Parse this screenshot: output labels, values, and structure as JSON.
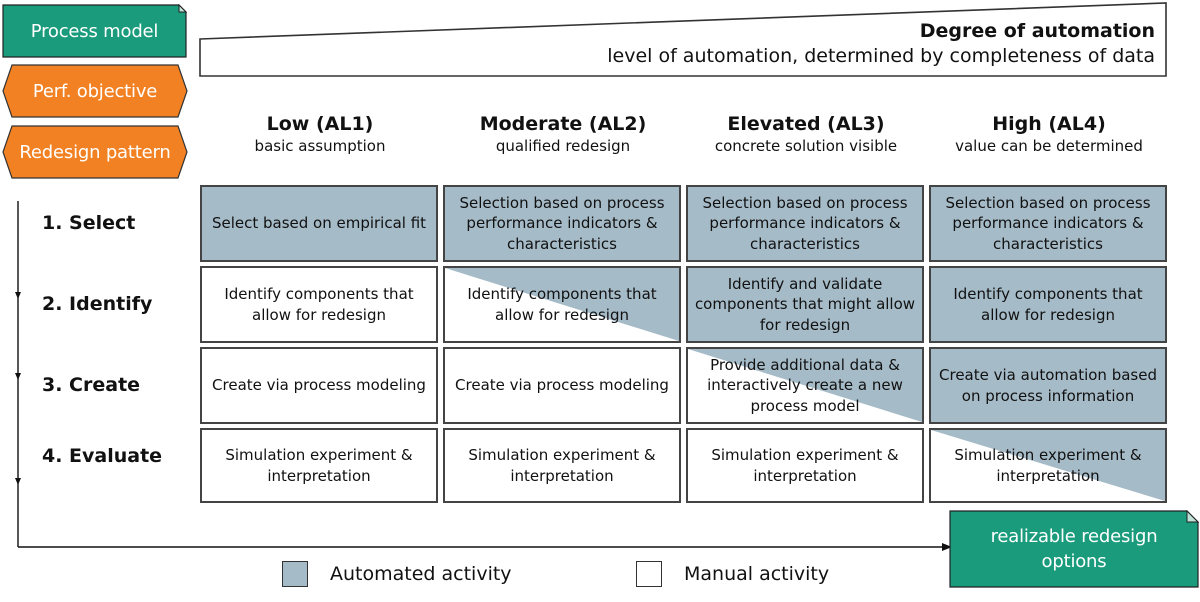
{
  "inputs": {
    "process_model": "Process model",
    "perf_objective": "Perf. objective",
    "redesign_pattern": "Redesign pattern"
  },
  "automation_scale": {
    "title": "Degree of automation",
    "subtitle": "level of automation, determined by completeness of data"
  },
  "columns": [
    {
      "title": "Low (AL1)",
      "subtitle": "basic assumption"
    },
    {
      "title": "Moderate (AL2)",
      "subtitle": "qualified redesign"
    },
    {
      "title": "Elevated (AL3)",
      "subtitle": "concrete solution visible"
    },
    {
      "title": "High (AL4)",
      "subtitle": "value can be determined"
    }
  ],
  "steps": [
    {
      "label": "1. Select"
    },
    {
      "label": "2. Identify"
    },
    {
      "label": "3. Create"
    },
    {
      "label": "4. Evaluate"
    }
  ],
  "cells": [
    [
      {
        "text": "Select based on empirical fit",
        "type": "automated"
      },
      {
        "text": "Selection based on  process performance indicators & characteristics",
        "type": "automated"
      },
      {
        "text": "Selection based on  process performance indicators & characteristics",
        "type": "automated"
      },
      {
        "text": "Selection based on  process performance indicators & characteristics",
        "type": "automated"
      }
    ],
    [
      {
        "text": "Identify components that allow for redesign",
        "type": "manual"
      },
      {
        "text": "Identify components that allow for redesign",
        "type": "partial"
      },
      {
        "text": "Identify and validate components that might allow for redesign",
        "type": "automated"
      },
      {
        "text": "Identify components that allow for redesign",
        "type": "automated"
      }
    ],
    [
      {
        "text": "Create via process modeling",
        "type": "manual"
      },
      {
        "text": "Create via process modeling",
        "type": "manual"
      },
      {
        "text": "Provide additional data & interactively create a new process model",
        "type": "partial"
      },
      {
        "text": "Create via automation based on process information",
        "type": "automated"
      }
    ],
    [
      {
        "text": "Simulation experiment & interpretation",
        "type": "manual"
      },
      {
        "text": "Simulation experiment & interpretation",
        "type": "manual"
      },
      {
        "text": "Simulation experiment & interpretation",
        "type": "manual"
      },
      {
        "text": "Simulation experiment & interpretation",
        "type": "partial"
      }
    ]
  ],
  "output": {
    "label": "realizable redesign options"
  },
  "legend": {
    "automated": "Automated activity",
    "manual": "Manual activity"
  },
  "colors": {
    "document_green": "#1a9b7c",
    "input_orange": "#f28123",
    "automated_fill": "#a6bbc8",
    "border": "#444444"
  }
}
